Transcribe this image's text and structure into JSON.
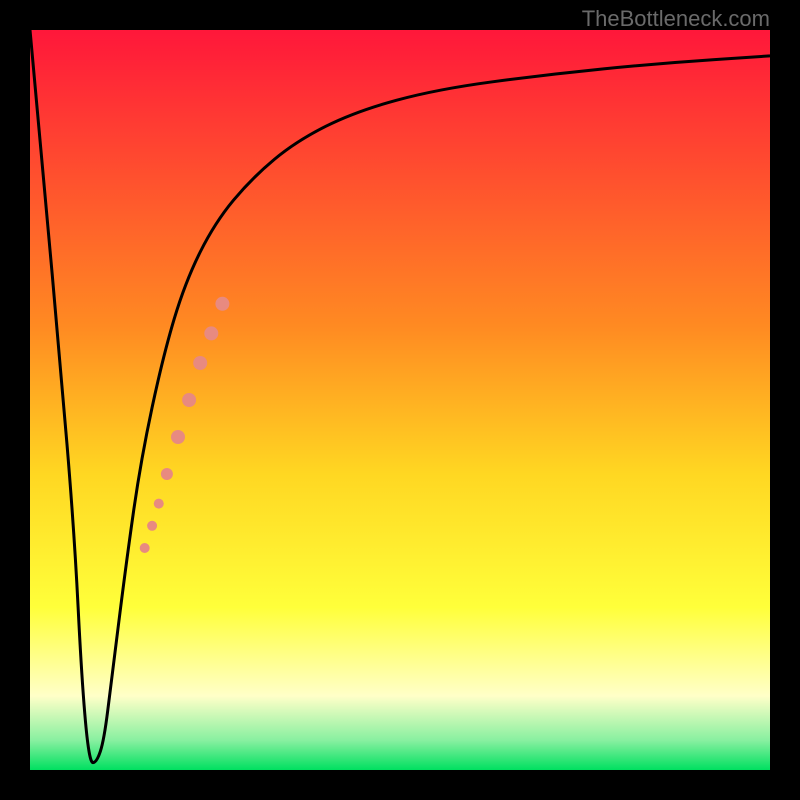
{
  "watermark": "TheBottleneck.com",
  "chart_data": {
    "type": "line",
    "title": "",
    "xlabel": "",
    "ylabel": "",
    "xlim": [
      0,
      100
    ],
    "ylim": [
      0,
      100
    ],
    "background_gradient": {
      "stops": [
        {
          "offset": 0,
          "color": "#ff173a"
        },
        {
          "offset": 40,
          "color": "#ff8a22"
        },
        {
          "offset": 60,
          "color": "#ffd722"
        },
        {
          "offset": 78,
          "color": "#ffff3a"
        },
        {
          "offset": 90,
          "color": "#ffffc8"
        },
        {
          "offset": 96,
          "color": "#88f0a0"
        },
        {
          "offset": 100,
          "color": "#00e060"
        }
      ]
    },
    "series": [
      {
        "name": "bottleneck-curve",
        "color": "#000000",
        "x": [
          0,
          2,
          4,
          6,
          7,
          8,
          9,
          10,
          11,
          13,
          15,
          18,
          21,
          25,
          30,
          36,
          44,
          55,
          70,
          85,
          100
        ],
        "y": [
          100,
          78,
          56,
          32,
          12,
          1,
          1,
          4,
          12,
          28,
          42,
          56,
          66,
          74,
          80,
          85,
          89,
          92,
          94,
          95.5,
          96.5
        ]
      }
    ],
    "highlight_segment": {
      "name": "highlight-band",
      "color": "#e88a80",
      "points": [
        {
          "x": 15.5,
          "y": 30,
          "r": 5
        },
        {
          "x": 16.5,
          "y": 33,
          "r": 5
        },
        {
          "x": 17.4,
          "y": 36,
          "r": 5
        },
        {
          "x": 18.5,
          "y": 40,
          "r": 6
        },
        {
          "x": 20.0,
          "y": 45,
          "r": 7
        },
        {
          "x": 21.5,
          "y": 50,
          "r": 7
        },
        {
          "x": 23.0,
          "y": 55,
          "r": 7
        },
        {
          "x": 24.5,
          "y": 59,
          "r": 7
        },
        {
          "x": 26.0,
          "y": 63,
          "r": 7
        }
      ]
    }
  }
}
